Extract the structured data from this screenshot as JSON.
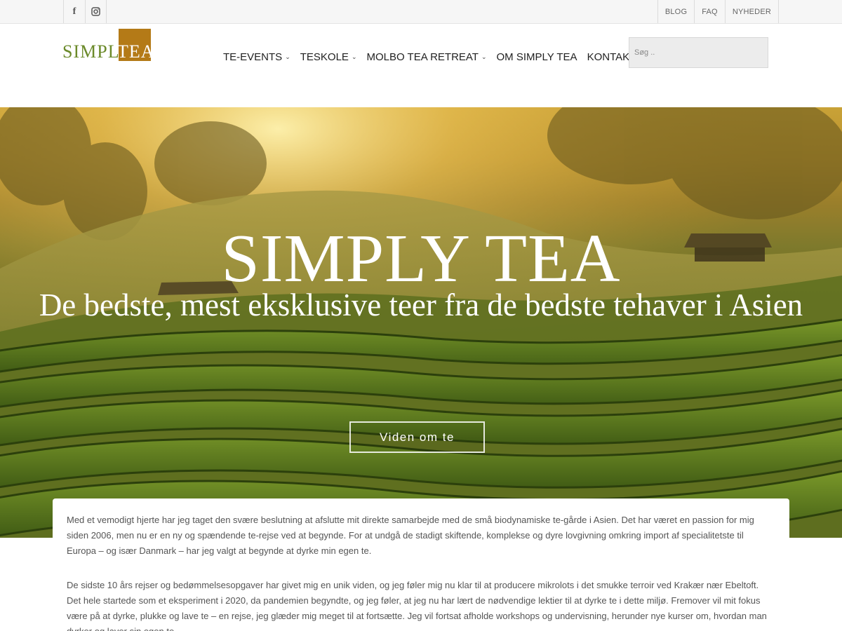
{
  "topbar": {
    "social": [
      {
        "icon": "facebook-icon",
        "glyph": "f"
      },
      {
        "icon": "instagram-icon"
      }
    ],
    "links": [
      "BLOG",
      "FAQ",
      "NYHEDER"
    ]
  },
  "header": {
    "logo_simply": "SIMPLY",
    "logo_tea": "TEA",
    "nav": [
      {
        "label": "TE-EVENTS",
        "has_dropdown": true
      },
      {
        "label": "TESKOLE",
        "has_dropdown": true
      },
      {
        "label": "MOLBO TEA RETREAT",
        "has_dropdown": true
      },
      {
        "label": "OM SIMPLY TEA",
        "has_dropdown": false
      },
      {
        "label": "KONTAKT",
        "has_dropdown": false
      }
    ],
    "search_placeholder": "Søg ..",
    "chevron": "⌄"
  },
  "hero": {
    "title": "SIMPLY TEA",
    "subtitle": "De bedste, mest eksklusive teer fra de bedste tehaver i Asien",
    "button": "Viden om te"
  },
  "content": {
    "paragraphs": [
      "Med et vemodigt hjerte har jeg taget den svære beslutning at afslutte mit direkte samarbejde med de små biodynamiske te-gårde i Asien. Det har været en passion for mig siden 2006, men nu er en ny og spændende te-rejse ved at begynde. For at undgå de stadigt skiftende, komplekse og dyre lovgivning omkring import af specialitetste til Europa – og især Danmark – har jeg valgt at begynde at dyrke min egen te.",
      "De sidste 10 års rejser og bedømmelsesopgaver har givet mig en unik viden, og jeg føler mig nu klar til at producere mikrolots i det smukke terroir ved Krakær nær Ebeltoft. Det hele startede som et eksperiment i 2020, da pandemien begyndte, og jeg føler, at jeg nu har lært de nødvendige lektier til at dyrke te i dette miljø. Fremover vil mit fokus være på at dyrke, plukke og lave te – en rejse, jeg glæder mig meget til at fortsætte. Jeg vil fortsat afholde workshops og undervisning, herunder nye kurser om, hvordan man dyrker og laver sin egen te."
    ]
  },
  "colors": {
    "logo_green": "#6b8a2a",
    "logo_gold": "#b47a17"
  }
}
